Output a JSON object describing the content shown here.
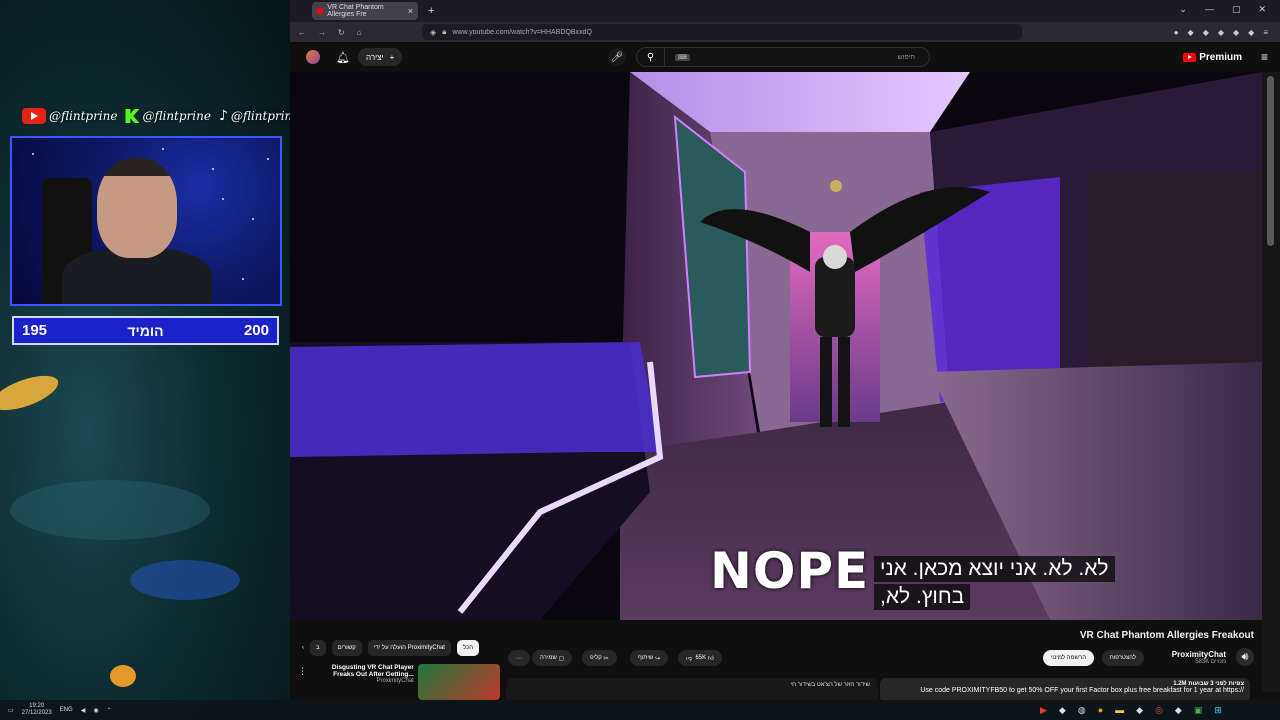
{
  "overlay": {
    "socials": [
      {
        "platform": "youtube-icon",
        "handle": "@flintprine"
      },
      {
        "platform": "kick-icon",
        "handle": "@flintprine"
      },
      {
        "platform": "tiktok-icon",
        "handle": "@flintprine"
      }
    ],
    "score": {
      "left": "195",
      "label": "הומיד",
      "right": "200"
    }
  },
  "browser": {
    "tab_title": "VR Chat Phantom Allergies Fre",
    "new_tab": "+",
    "url": "www.youtube.com/watch?v=HHABDQBxxdQ"
  },
  "youtube": {
    "create_label": "יצירה",
    "search_placeholder": "חיפוש",
    "search_key": "⌨",
    "logo_text": "Premium"
  },
  "video": {
    "subtitle_line1": "לא. לא. אני יוצא מכאן.  אני",
    "subtitle_line2": "בחוץ.  לא,",
    "overlay_text": "NOPE"
  },
  "details": {
    "title": "VR Chat Phantom Allergies Freakout",
    "channel": "ProximityChat",
    "subscribers": "583K מנויים",
    "join_label": "להצטרפות",
    "subscribe_label": "הרשמה למינוי",
    "like_count": "65K",
    "share_label": "שיתוף",
    "clip_label": "קליפ",
    "save_label": "שמירה",
    "views_meta": "1.2M צפיות  לפני 3 שבועות",
    "description": "Use code PROXIMITYFB50 to get 50% OFF your first Factor box plus free breakfast for 1 year at https://",
    "comment_preview": "שידור חוזר של הצ'אט בשידור חי"
  },
  "chips": [
    "הכל",
    "הועלה על ידי ProximityChat",
    "קשורים",
    "ב"
  ],
  "related": {
    "title": "Disgusting VR Chat Player Freaks Out After Getting...",
    "channel": "ProximityChat"
  },
  "taskbar": {
    "time": "19:20",
    "date": "27/12/2023",
    "lang": "ENG"
  }
}
